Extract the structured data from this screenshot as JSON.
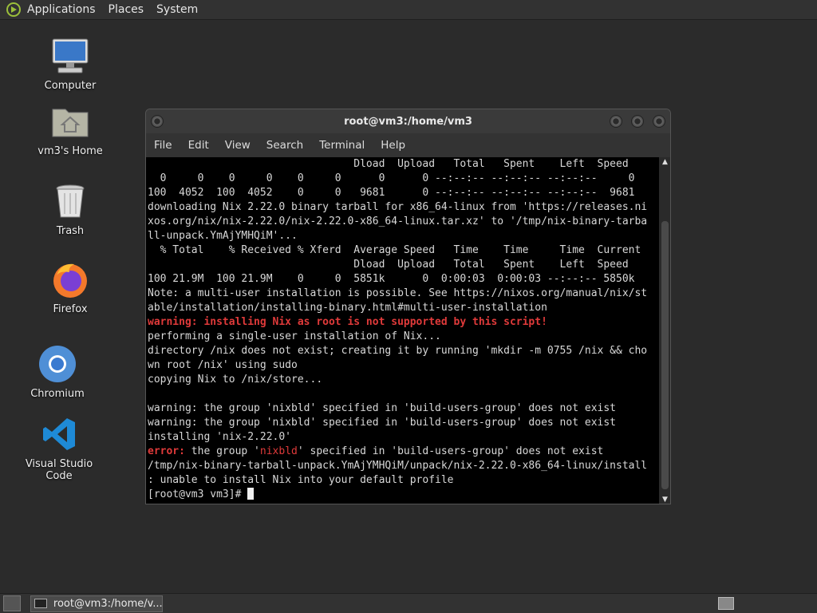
{
  "top_panel": {
    "menus": [
      "Applications",
      "Places",
      "System"
    ]
  },
  "desktop": {
    "icons": [
      {
        "label": "Computer"
      },
      {
        "label": "vm3's Home"
      },
      {
        "label": "Trash"
      },
      {
        "label": "Firefox"
      },
      {
        "label": "Chromium"
      },
      {
        "label": "Visual Studio Code"
      }
    ]
  },
  "terminal": {
    "title": "root@vm3:/home/vm3",
    "menu": [
      "File",
      "Edit",
      "View",
      "Search",
      "Terminal",
      "Help"
    ],
    "lines": [
      "                                 Dload  Upload   Total   Spent    Left  Speed",
      "  0     0    0     0    0     0      0      0 --:--:-- --:--:-- --:--:--     0",
      "100  4052  100  4052    0     0   9681      0 --:--:-- --:--:-- --:--:--  9681",
      "downloading Nix 2.22.0 binary tarball for x86_64-linux from 'https://releases.ni",
      "xos.org/nix/nix-2.22.0/nix-2.22.0-x86_64-linux.tar.xz' to '/tmp/nix-binary-tarba",
      "ll-unpack.YmAjYMHQiM'...",
      "  % Total    % Received % Xferd  Average Speed   Time    Time     Time  Current",
      "                                 Dload  Upload   Total   Spent    Left  Speed",
      "100 21.9M  100 21.9M    0     0  5851k      0  0:00:03  0:00:03 --:--:-- 5850k",
      "Note: a multi-user installation is possible. See https://nixos.org/manual/nix/st",
      "able/installation/installing-binary.html#multi-user-installation",
      "warning: installing Nix as root is not supported by this script!",
      "performing a single-user installation of Nix...",
      "directory /nix does not exist; creating it by running 'mkdir -m 0755 /nix && cho",
      "wn root /nix' using sudo",
      "copying Nix to /nix/store...",
      "",
      "warning: the group 'nixbld' specified in 'build-users-group' does not exist",
      "warning: the group 'nixbld' specified in 'build-users-group' does not exist",
      "installing 'nix-2.22.0'",
      "the group 'nixbld' specified in 'build-users-group' does not exist",
      "/tmp/nix-binary-tarball-unpack.YmAjYMHQiM/unpack/nix-2.22.0-x86_64-linux/install",
      ": unable to install Nix into your default profile",
      "[root@vm3 vm3]# "
    ],
    "error_prefix": "error:",
    "error_rest_1": " the group '",
    "error_highlight": "nixbld",
    "error_rest_2": "' specified in 'build-users-group' does not exist",
    "colors": {
      "error": "#e03a3a",
      "background": "#000000",
      "text": "#d8d8d8"
    }
  },
  "bottom_panel": {
    "task_label": "root@vm3:/home/v..."
  }
}
